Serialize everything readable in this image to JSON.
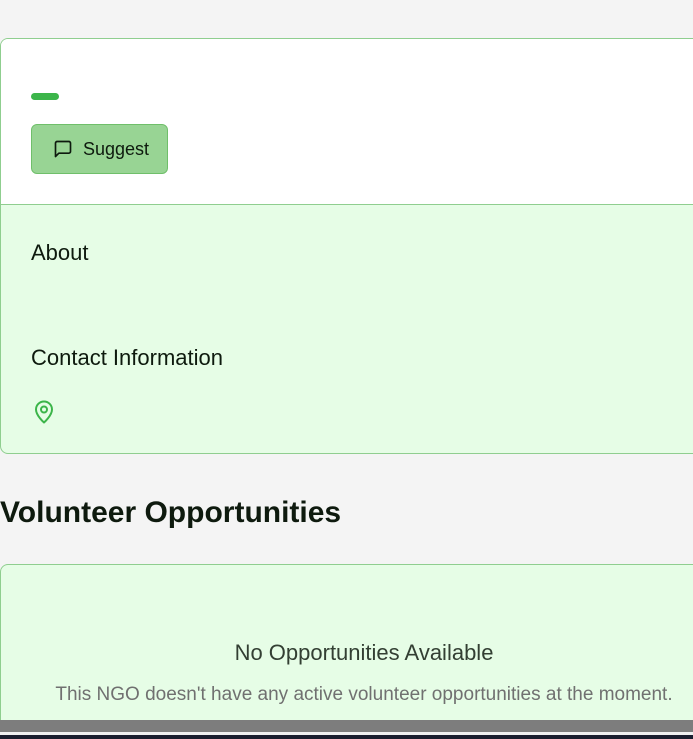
{
  "profile": {
    "accent_color": "#3cb54a",
    "suggest_button": {
      "label": "Suggest",
      "icon": "message-square-icon"
    },
    "about": {
      "heading": "About"
    },
    "contact": {
      "heading": "Contact Information",
      "location_icon": "map-pin-icon"
    }
  },
  "volunteer": {
    "section_title": "Volunteer Opportunities",
    "empty_state": {
      "title": "No Opportunities Available",
      "message": "This NGO doesn't have any active volunteer opportunities at the moment."
    }
  },
  "colors": {
    "card_background": "#e6fde6",
    "card_border": "#8fce8f",
    "button_background": "#98d494",
    "page_background": "#f4f4f4"
  }
}
